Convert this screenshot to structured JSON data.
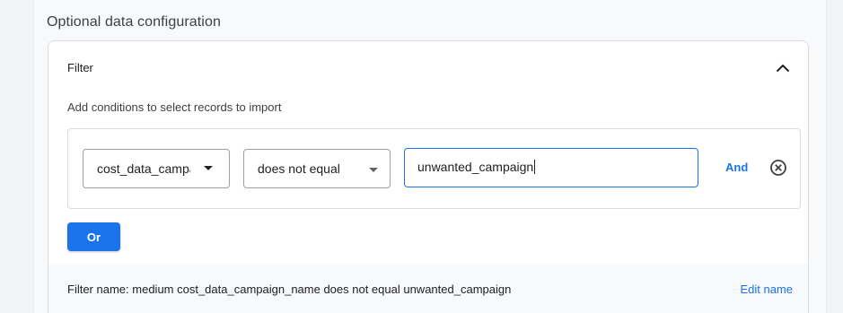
{
  "section": {
    "title": "Optional data configuration"
  },
  "filter_card": {
    "title": "Filter",
    "collapse_icon": "chevron-up-icon",
    "hint": "Add conditions to select records to import",
    "condition": {
      "field": "cost_data_campaign_name",
      "field_visible": "cost_data_campa",
      "operator": "does not equal",
      "value": "unwanted_campaign",
      "and_label": "And",
      "remove_icon": "close-circle-icon"
    },
    "or_label": "Or",
    "footer": {
      "filter_name_label": "Filter name:",
      "filter_name_value": "medium cost_data_campaign_name does not equal unwanted_campaign",
      "edit_label": "Edit name"
    }
  },
  "colors": {
    "accent": "#1a73e8",
    "background": "#f1f3f4",
    "card": "#ffffff",
    "border": "#dadce0"
  }
}
